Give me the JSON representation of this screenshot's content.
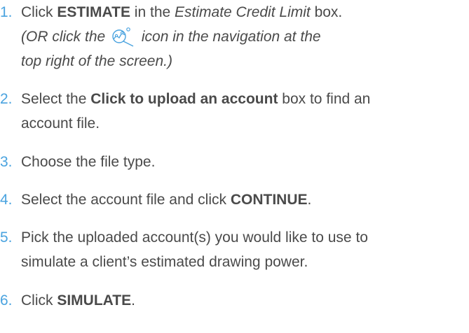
{
  "steps": [
    {
      "number": "1.",
      "parts": [
        "Click ",
        "ESTIMATE",
        " in the ",
        "Estimate Credit Limit",
        " box."
      ],
      "note_before_icon": "(OR click the ",
      "icon": "estimate-chart-icon",
      "note_after_icon_line1": " icon in the navigation at the",
      "note_line2": "top right of the screen.)"
    },
    {
      "number": "2.",
      "parts": [
        "Select the ",
        "Click to upload an account",
        " box to find an"
      ],
      "line2": "account file."
    },
    {
      "number": "3.",
      "text": "Choose the file type."
    },
    {
      "number": "4.",
      "parts": [
        "Select the account file and click ",
        "CONTINUE",
        "."
      ]
    },
    {
      "number": "5.",
      "line1": "Pick the uploaded account(s) you would like to use to",
      "line2": "simulate a client’s estimated drawing power."
    },
    {
      "number": "6.",
      "parts": [
        "Click ",
        "SIMULATE",
        "."
      ]
    }
  ],
  "colors": {
    "number": "#4aa3df",
    "text": "#4a4a4a",
    "icon": "#4aa3df"
  }
}
